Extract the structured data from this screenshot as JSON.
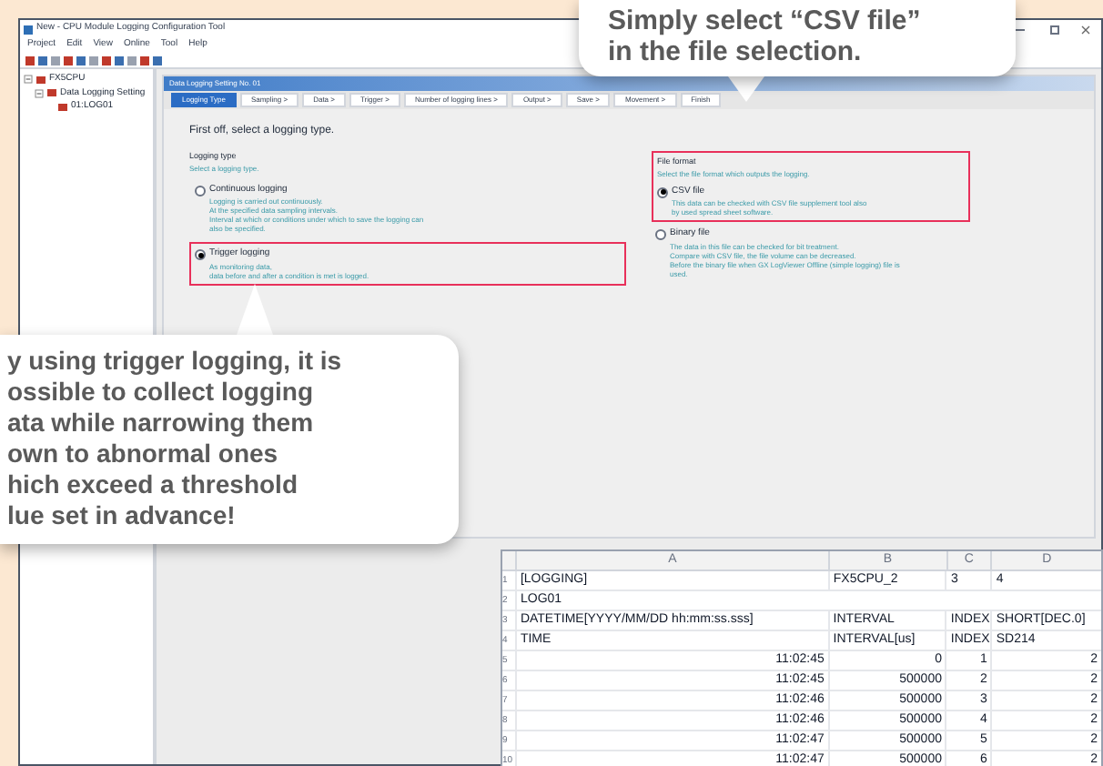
{
  "window": {
    "title": "New - CPU Module Logging Configuration Tool"
  },
  "menu": [
    "Project",
    "Edit",
    "View",
    "Online",
    "Tool",
    "Help"
  ],
  "tree": [
    {
      "label": "FX5CPU",
      "expanded": true,
      "children": [
        {
          "label": "Data Logging Setting",
          "expanded": true,
          "children": [
            {
              "label": "01:LOG01"
            }
          ]
        }
      ]
    }
  ],
  "dialog": {
    "title": "Data Logging Setting No. 01",
    "tabs": [
      {
        "label": "Logging Type",
        "selected": true
      },
      {
        "label": "Sampling >",
        "selected": false
      },
      {
        "label": "Data >",
        "selected": false
      },
      {
        "label": "Trigger >",
        "selected": false
      },
      {
        "label": "Number of logging lines >",
        "selected": false
      },
      {
        "label": "Output >",
        "selected": false
      },
      {
        "label": "Save >",
        "selected": false
      },
      {
        "label": "Movement >",
        "selected": false
      },
      {
        "label": "Finish",
        "selected": false
      }
    ],
    "heading": "First off, select a logging type.",
    "logging_type": {
      "label": "Logging type",
      "hint": "Select a logging type.",
      "options": [
        {
          "label": "Continuous logging",
          "selected": false,
          "highlighted": false,
          "description": [
            "Logging is carried out continuously.",
            "At the specified data sampling intervals.",
            "Interval at which or conditions under which to save the logging can",
            "also be specified."
          ]
        },
        {
          "label": "Trigger logging",
          "selected": true,
          "highlighted": true,
          "description": [
            "As monitoring data,",
            "data before and after a condition is met is logged."
          ]
        }
      ]
    },
    "file_format": {
      "label": "File format",
      "hint": "Select the file format which outputs the logging.",
      "highlighted": true,
      "options": [
        {
          "label": "CSV file",
          "selected": true,
          "description": [
            "This data can be checked with CSV file supplement tool also",
            "by used spread sheet software."
          ]
        },
        {
          "label": "Binary file",
          "selected": false,
          "description": [
            "The data in this file can be checked for bit treatment.",
            "Compare with CSV file, the file volume can be decreased.",
            "Before the binary file when GX LogViewer Offline (simple logging) file is",
            "used."
          ]
        }
      ]
    }
  },
  "callouts": [
    {
      "kind": "top",
      "lines": [
        "Simply select “CSV file”",
        "in the file selection."
      ]
    },
    {
      "kind": "left",
      "lines": [
        "y using trigger logging, it is",
        "ossible to collect logging",
        "ata while narrowing them",
        "own to abnormal ones",
        "hich exceed a threshold",
        "lue set in advance!"
      ]
    }
  ],
  "spreadsheet": {
    "columns": [
      "A",
      "B",
      "C",
      "D"
    ],
    "rows": [
      {
        "num": "1",
        "kind": "meta",
        "cells": [
          "[LOGGING]",
          "FX5CPU_2",
          "3",
          "4"
        ]
      },
      {
        "num": "2",
        "kind": "meta",
        "cells": [
          "LOG01"
        ]
      },
      {
        "num": "3",
        "kind": "meta",
        "cells": [
          "DATETIME[YYYY/MM/DD hh:mm:ss.sss]",
          "INTERVAL",
          "INDEX",
          "SHORT[DEC.0]"
        ]
      },
      {
        "num": "4",
        "kind": "meta",
        "cells": [
          "TIME",
          "INTERVAL[us]",
          "INDEX",
          "SD214"
        ]
      },
      {
        "num": "5",
        "kind": "data",
        "cells": [
          "11:02:45",
          "0",
          "1",
          "2"
        ]
      },
      {
        "num": "6",
        "kind": "data",
        "cells": [
          "11:02:45",
          "500000",
          "2",
          "2"
        ]
      },
      {
        "num": "7",
        "kind": "data",
        "cells": [
          "11:02:46",
          "500000",
          "3",
          "2"
        ]
      },
      {
        "num": "8",
        "kind": "data",
        "cells": [
          "11:02:46",
          "500000",
          "4",
          "2"
        ]
      },
      {
        "num": "9",
        "kind": "data",
        "cells": [
          "11:02:47",
          "500000",
          "5",
          "2"
        ]
      },
      {
        "num": "10",
        "kind": "data",
        "cells": [
          "11:02:47",
          "500000",
          "6",
          "2"
        ]
      }
    ]
  }
}
